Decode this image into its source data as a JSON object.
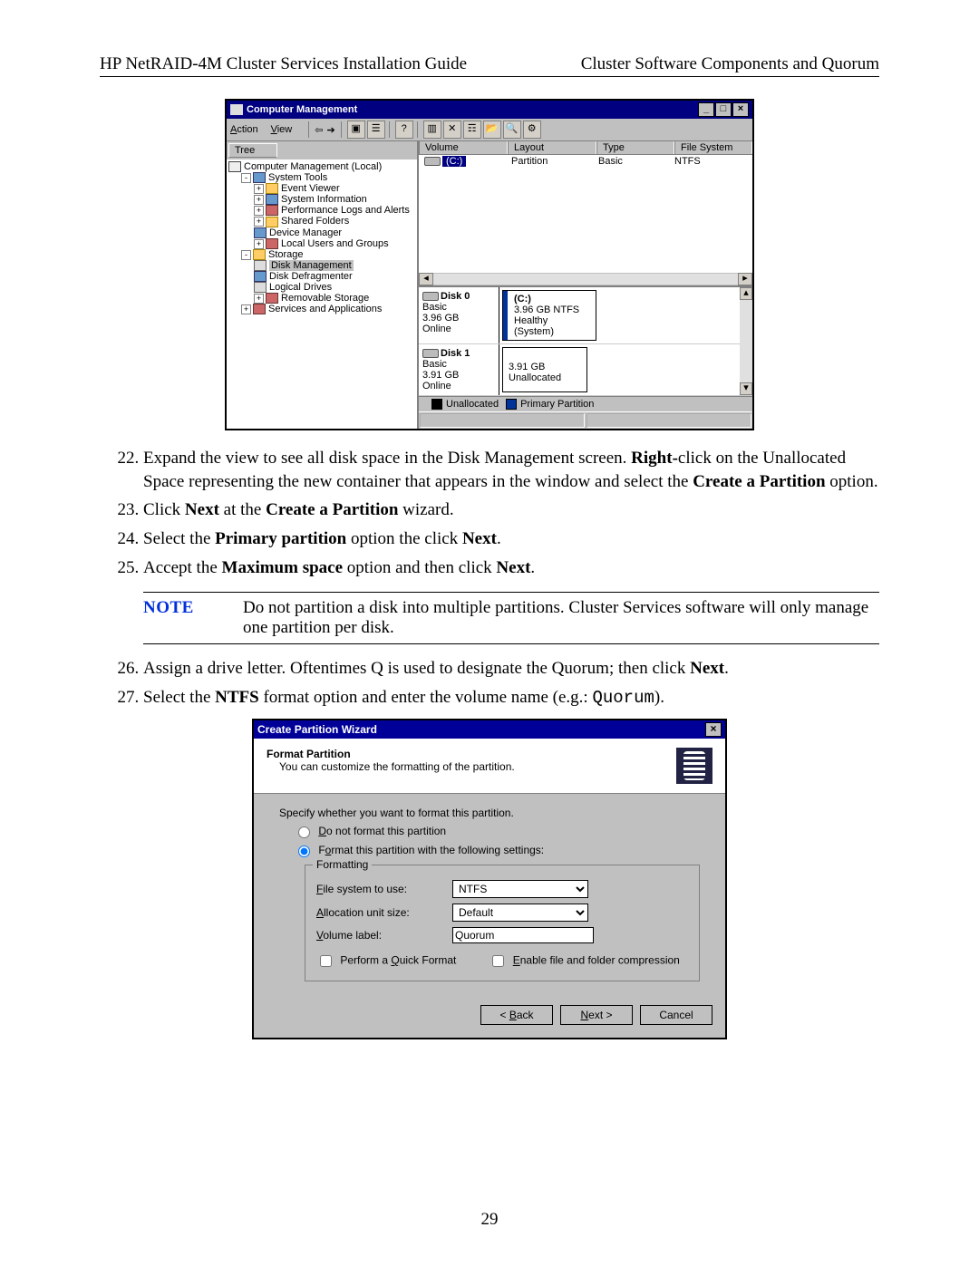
{
  "header": {
    "left": "HP NetRAID-4M Cluster Services Installation Guide",
    "right": "Cluster Software Components and Quorum"
  },
  "page_number": "29",
  "cm": {
    "title": "Computer Management",
    "menu": {
      "action": "Action",
      "view": "View"
    },
    "win_buttons": {
      "min": "_",
      "max": "□",
      "close": "×"
    },
    "back": "⇦",
    "fwd": "➔",
    "tree_tab": "Tree",
    "tree": {
      "root": "Computer Management (Local)",
      "system_tools": "System Tools",
      "event_viewer": "Event Viewer",
      "system_info": "System Information",
      "perf_logs": "Performance Logs and Alerts",
      "shared_folders": "Shared Folders",
      "device_manager": "Device Manager",
      "local_users": "Local Users and Groups",
      "storage": "Storage",
      "disk_mgmt": "Disk Management",
      "defrag": "Disk Defragmenter",
      "logical_drives": "Logical Drives",
      "removable": "Removable Storage",
      "services_apps": "Services and Applications"
    },
    "vol_headers": {
      "volume": "Volume",
      "layout": "Layout",
      "type": "Type",
      "fs": "File System"
    },
    "vol_row": {
      "name": "(C:)",
      "layout": "Partition",
      "type": "Basic",
      "fs": "NTFS"
    },
    "disks": [
      {
        "label": "Disk 0",
        "kind": "Basic",
        "size": "3.96 GB",
        "status": "Online",
        "part_title": "(C:)",
        "part_line2": "3.96 GB NTFS",
        "part_line3": "Healthy (System)",
        "primary": true
      },
      {
        "label": "Disk 1",
        "kind": "Basic",
        "size": "3.91 GB",
        "status": "Online",
        "part_title": "",
        "part_line2": "3.91 GB",
        "part_line3": "Unallocated",
        "primary": false
      }
    ],
    "legend": {
      "unallocated": "Unallocated",
      "primary": "Primary Partition"
    }
  },
  "steps": {
    "s22a": "Expand the view to see all disk space in the Disk Management screen. ",
    "s22b": "Right-",
    "s22c": "click on the Unallocated Space representing the new container that appears in the window and select the ",
    "s22d": "Create a Partition",
    "s22e": " option.",
    "s23a": "Click ",
    "s23b": "Next",
    "s23c": " at the ",
    "s23d": "Create a Partition",
    "s23e": " wizard.",
    "s24a": "Select the ",
    "s24b": "Primary partition",
    "s24c": " option the click ",
    "s24d": "Next",
    "s24e": ".",
    "s25a": "Accept the ",
    "s25b": "Maximum space",
    "s25c": " option and then click ",
    "s25d": "Next",
    "s25e": ".",
    "s26a": "Assign a drive letter.  Oftentimes Q is used to designate the Quorum; then click ",
    "s26b": "Next",
    "s26c": ".",
    "s27a": "Select the ",
    "s27b": "NTFS",
    "s27c": " format option and enter the volume name (e.g.: ",
    "s27d": "Quorum",
    "s27e": ")."
  },
  "note": {
    "label": "NOTE",
    "text": "Do not partition a disk into multiple partitions. Cluster Services software will only manage one partition per disk."
  },
  "wiz": {
    "title": "Create Partition Wizard",
    "close": "×",
    "h_title": "Format Partition",
    "h_sub": "You can customize the formatting of the partition.",
    "prompt": "Specify whether you want to format this partition.",
    "opt_noformat": "Do not format this partition",
    "opt_format": "Format this partition with the following settings:",
    "group_legend": "Formatting",
    "fs_label": "File system to use:",
    "fs_value": "NTFS",
    "au_label": "Allocation unit size:",
    "au_value": "Default",
    "vl_label": "Volume label:",
    "vl_value": "Quorum",
    "chk_quick": "Perform a Quick Format",
    "chk_compress": "Enable file and folder compression",
    "btn_back": "< Back",
    "btn_next": "Next >",
    "btn_cancel": "Cancel"
  }
}
